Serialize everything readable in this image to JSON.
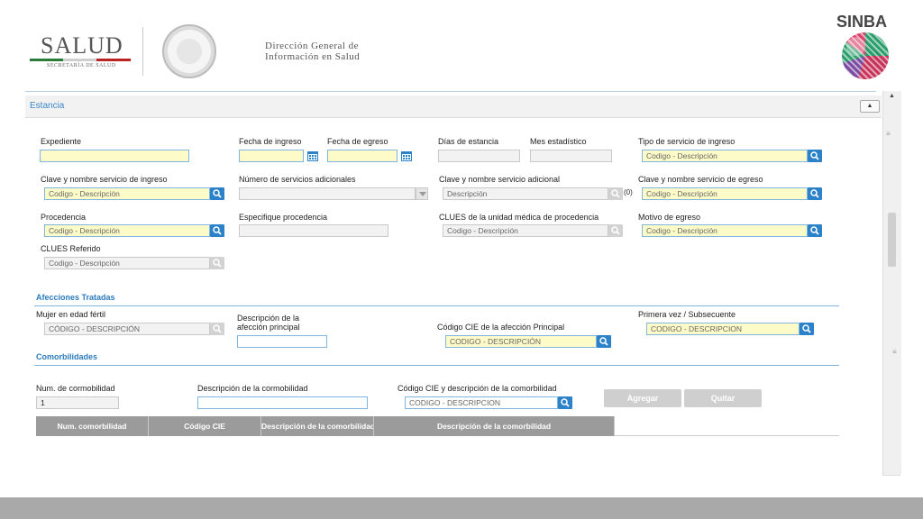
{
  "header": {
    "salud_title": "SALUD",
    "salud_subtitle": "SECRETARÍA DE SALUD",
    "dg_line1": "Dirección General de",
    "dg_line2": "Información en Salud",
    "sinba_title": "SINBA"
  },
  "section": {
    "title": "Estancia",
    "collapse_symbol": "▲"
  },
  "scrollbar": {
    "up_symbol": "▲",
    "grip_symbol": "≡"
  },
  "fields": {
    "expediente": {
      "label": "Expediente",
      "value": ""
    },
    "fecha_ingreso": {
      "label": "Fecha de ingreso",
      "value": ""
    },
    "fecha_egreso": {
      "label": "Fecha de egreso",
      "value": ""
    },
    "dias_estancia": {
      "label": "Días de estancia",
      "value": ""
    },
    "mes_estadistico": {
      "label": "Mes estadístico",
      "value": ""
    },
    "tipo_servicio_ingreso": {
      "label": "Tipo de servicio de ingreso",
      "placeholder": "Codigo - Descripción"
    },
    "clave_servicio_ingreso": {
      "label": "Clave y nombre servicio de ingreso",
      "placeholder": "Codigo - Descripción"
    },
    "num_servicios_adicionales": {
      "label": "Número de servicios adicionales",
      "value": ""
    },
    "clave_servicio_adicional": {
      "label": "Clave y nombre servicio adicional",
      "placeholder": "Descripción",
      "count": "(0)"
    },
    "clave_servicio_egreso": {
      "label": "Clave y nombre servicio de egreso",
      "placeholder": "Codigo - Descripción"
    },
    "procedencia": {
      "label": "Procedencia",
      "placeholder": "Codigo - Descripción"
    },
    "especifique_procedencia": {
      "label": "Especifique procedencia",
      "value": ""
    },
    "clues_procedencia": {
      "label": "CLUES de la unidad médica de procedencia",
      "placeholder": "Codigo - Descripción"
    },
    "motivo_egreso": {
      "label": "Motivo de egreso",
      "placeholder": "Codigo - Descripción"
    },
    "clues_referido": {
      "label": "CLUES Referido",
      "placeholder": "Codigo - Descripción"
    }
  },
  "afecciones": {
    "title": "Afecciones Tratadas",
    "mujer_fertil": {
      "label": "Mujer en edad fértil",
      "placeholder": "CÓDIGO - DESCRIPCIÓN"
    },
    "desc_afeccion": {
      "label_line1": "Descripción de la",
      "label_line2": "afección principal",
      "value": ""
    },
    "cie_principal": {
      "label": "Código CIE de la afección Principal",
      "placeholder": "CODIGO - DESCRIPCIÓN"
    },
    "primera_vez": {
      "label": "Primera vez / Subsecuente",
      "placeholder": "CODIGO - DESCRIPCION"
    }
  },
  "comorbilidades": {
    "title": "Comorbilidades",
    "num": {
      "label": "Num. de cormobilidad",
      "value": "1"
    },
    "descripcion": {
      "label": "Descripción de la cormobilidad",
      "value": ""
    },
    "cie": {
      "label": "Código CIE y descripción de la comorbilidad",
      "placeholder": "CODIGO - DESCRIPCION"
    },
    "agregar_label": "Agregar",
    "quitar_label": "Quitar",
    "table_headers": [
      "Num. comorbilidad",
      "Código CIE",
      "Descripción de la comorbilidad",
      "Descripción de la comorbilidad"
    ]
  },
  "colors": {
    "accent": "#2c82c9",
    "required_field": "#fdfbc8",
    "section_title": "#3a86c8",
    "table_header": "#9b9b9b",
    "footer": "#a9a9a9"
  }
}
